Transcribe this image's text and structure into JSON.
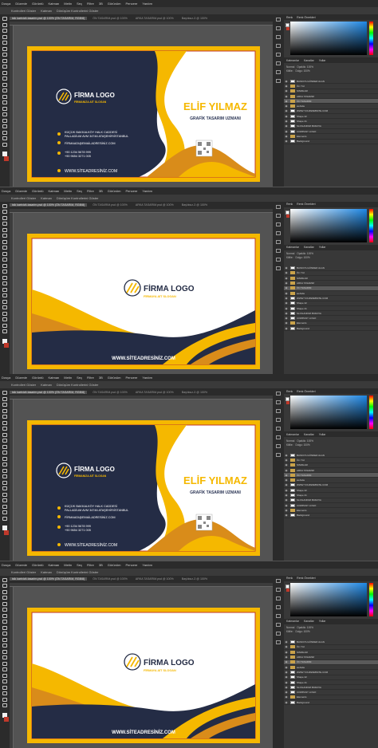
{
  "menu": [
    "Dosya",
    "Düzenle",
    "Görüntü",
    "Katman",
    "Metin",
    "Seç",
    "Filtre",
    "3B",
    "Görünüm",
    "Pencere",
    "Yardım"
  ],
  "options": [
    "Kontrolleri Göster",
    "Katman",
    "Dönüşüm Kontrollerini Göster"
  ],
  "tabs": [
    "isik kartvizit-tasarim.psd @ 100% (ÖN TASARIM, RGB/8)",
    "ÖN TASARIM.psd @ 100%",
    "ARKA TASARIM.psd @ 100%",
    "Başlıksız-3 @ 100%"
  ],
  "right_panel": {
    "color_tabs": [
      "Renk",
      "Renk Örnekleri"
    ],
    "layer_tabs": [
      "Katmanlar",
      "Kanallar",
      "Yollar"
    ],
    "blend_mode": "Normal",
    "opacity_label": "Opaklık: 100%",
    "lock_label": "Kilitle:",
    "fill_label": "Dolgu: 100%",
    "layers": [
      {
        "name": "BASKIYA GÖNDER ALAN",
        "type": "layer"
      },
      {
        "name": "Ön Yüz",
        "type": "folder"
      },
      {
        "name": "SINIRLAR",
        "type": "folder"
      },
      {
        "name": "ARKA TASARIM",
        "type": "folder"
      },
      {
        "name": "ÖN TASARIM",
        "type": "folder",
        "active": true
      },
      {
        "name": "website",
        "type": "folder"
      },
      {
        "name": "WWW.YOURWEBSITE.COM",
        "type": "text"
      },
      {
        "name": "Shape 42",
        "type": "layer"
      },
      {
        "name": "Shape 41",
        "type": "layer"
      },
      {
        "name": "SLOGANINIZ BURAYA",
        "type": "text"
      },
      {
        "name": "COMPANY LOGO",
        "type": "text"
      },
      {
        "name": "Elements",
        "type": "folder"
      },
      {
        "name": "Background",
        "type": "layer"
      }
    ]
  },
  "cards": [
    {
      "side": "front",
      "company": "FİRMA LOGO",
      "slogan": "FİRMANIZA AİT SLOGAN",
      "name": "ELİF YILMAZ",
      "title": "GRAFİK TASARIM UZMANI",
      "address_line1": "KÜÇÜK BAKKALKÖY HALK CADDESİ",
      "address_line2": "PALLADİUM AVM 34746 ATAŞEHİR/İSTANBUL",
      "email": "FİRMAADI@EMAİLADRESİNİZ.COM",
      "phone1": "+90 1234 5678 999",
      "phone2": "+90 9654 3271 005",
      "website": "WWW.SİTEADRESİNİZ.COM"
    },
    {
      "side": "back",
      "company": "FİRMA LOGO",
      "slogan": "FİRMAYA AİT SLOGAN",
      "website": "WWW.SİTEADRESİNİZ.COM"
    },
    {
      "side": "front",
      "company": "FİRMA LOGO",
      "slogan": "FİRMANIZA AİT SLOGAN",
      "name": "ELİF YILMAZ",
      "title": "GRAFİK TASARIM UZMANI",
      "address_line1": "KÜÇÜK BAKKALKÖY HALK CADDESİ",
      "address_line2": "PALLADİUM AVM 34746 ATAŞEHİR/İSTANBUL",
      "email": "FİRMAADI@EMAİLADRESİNİZ.COM",
      "phone1": "+90 1234 5678 999",
      "phone2": "+90 9654 3271 005",
      "website": "WWW.SİTEADRESİNİZ.COM"
    },
    {
      "side": "back",
      "company": "FİRMA LOGO",
      "slogan": "FİRMAYA AİT SLOGAN",
      "website": "WWW.SİTEADRESİNİZ.COM"
    }
  ],
  "colors": {
    "navy": "#242c45",
    "gold": "#f5b800",
    "orange": "#d98c1a",
    "red_border": "#c0392b",
    "ps_dark": "#2b2b2b",
    "ps_mid": "#535353"
  }
}
